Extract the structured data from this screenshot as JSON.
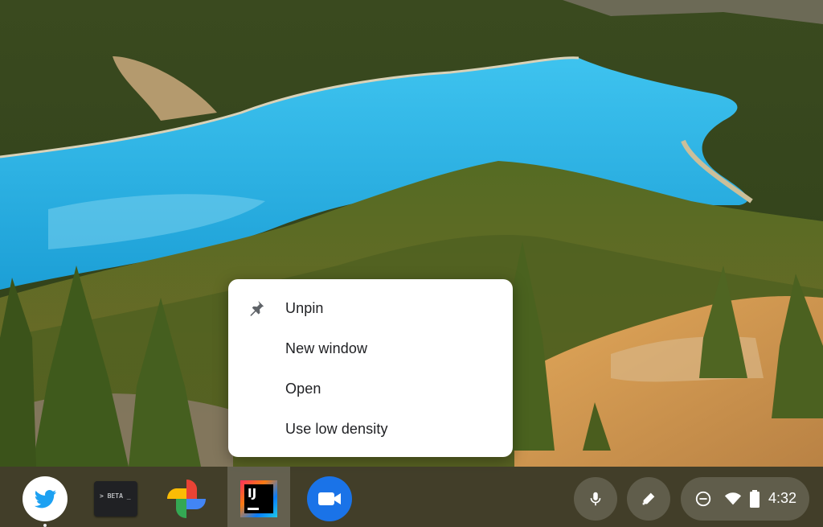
{
  "context_menu": {
    "items": [
      {
        "label": "Unpin",
        "icon": "pin-icon"
      },
      {
        "label": "New window",
        "icon": ""
      },
      {
        "label": "Open",
        "icon": ""
      },
      {
        "label": "Use low density",
        "icon": ""
      }
    ]
  },
  "shelf": {
    "apps": [
      {
        "name": "Twitter",
        "icon": "twitter-bird-icon",
        "running": true
      },
      {
        "name": "Terminal",
        "icon": "terminal-icon",
        "icon_text": "> BETA _",
        "running": false
      },
      {
        "name": "Google Photos",
        "icon": "pinwheel-icon",
        "running": false
      },
      {
        "name": "IntelliJ IDEA",
        "icon": "intellij-icon",
        "icon_text": "IJ",
        "running": false,
        "selected": true
      },
      {
        "name": "Google Duo",
        "icon": "video-camera-icon",
        "running": false
      }
    ],
    "tray": {
      "microphone": "microphone-icon",
      "stylus": "stylus-icon",
      "dnd": "do-not-disturb-icon",
      "wifi": "wifi-icon",
      "battery": "battery-icon",
      "clock": "4:32"
    }
  },
  "colors": {
    "menu_background": "#ffffff",
    "menu_text": "#202124",
    "shelf_background": "#3c342c",
    "duo_blue": "#1a73e8",
    "twitter_blue": "#1da1f2"
  }
}
